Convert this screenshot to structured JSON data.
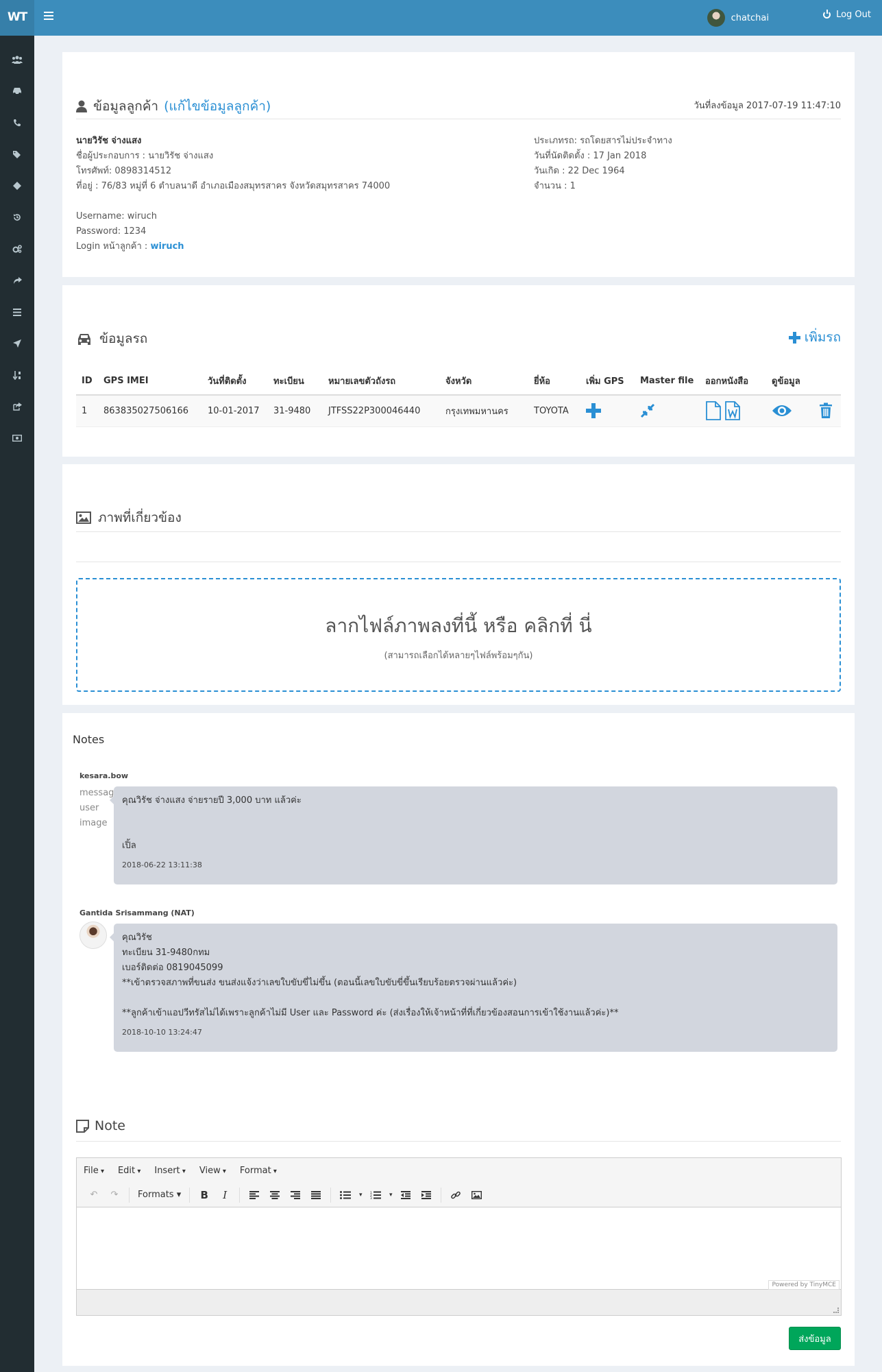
{
  "header": {
    "logo": "WT",
    "user_name": "chatchai",
    "logout_label": "Log Out"
  },
  "sidebar": {
    "icons": [
      "users-icon",
      "car-icon",
      "phone-icon",
      "tags-icon",
      "ticket-icon",
      "history-icon",
      "cogs-icon",
      "share-icon",
      "list-icon",
      "location-arrow-icon",
      "sort-icon",
      "share-square-icon",
      "money-icon"
    ]
  },
  "customer": {
    "title": "ข้อมูลลูกค้า",
    "edit_link": "(แก้ไขข้อมูลลูกค้า)",
    "record_date": "วันที่ลงข้อมูล 2017-07-19 11:47:10",
    "name": "นายวิรัช จ่างแสง",
    "operator": "ชื่อผู้ประกอบการ : นายวิรัช จ่างแสง",
    "phone": "โทรศัพท์: 0898314512",
    "address": "ที่อยู่ : 76/83 หมู่ที่ 6 ตำบลนาดี อำเภอเมืองสมุทรสาคร จังหวัดสมุทรสาคร 74000",
    "username": "Username: wiruch",
    "password": "Password: 1234",
    "login_label": "Login หน้าลูกค้า :",
    "login_link": "wiruch",
    "car_type": "ประเภทรถ: รถโดยสารไม่ประจำทาง",
    "install_date": "วันที่นัดติดตั้ง : 17 Jan 2018",
    "birth_date": "วันเกิด : 22 Dec 1964",
    "count": "จำนวน : 1"
  },
  "vehicles": {
    "title": "ข้อมูลรถ",
    "add_label": "เพิ่มรถ",
    "columns": [
      "ID",
      "GPS IMEI",
      "วันที่ติดตั้ง",
      "ทะเบียน",
      "หมายเลขตัวถังรถ",
      "จังหวัด",
      "ยี่ห้อ",
      "เพิ่ม GPS",
      "Master file",
      "ออกหนังสือ",
      "ดูข้อมูล"
    ],
    "rows": [
      {
        "id": "1",
        "imei": "863835027506166",
        "date": "10-01-2017",
        "plate": "31-9480",
        "chassis": "JTFSS22P300046440",
        "province": "กรุงเทพมหานคร",
        "brand": "TOYOTA"
      }
    ]
  },
  "images": {
    "title": "ภาพที่เกี่ยวข้อง",
    "dropzone_main": "ลากไฟล์ภาพลงที่นี้ หรือ คลิกที่ นี่",
    "dropzone_sub": "(สามารถเลือกได้หลายๆไฟล์พร้อมๆกัน)"
  },
  "notes": {
    "title": "Notes",
    "items": [
      {
        "author": "kesara.bow",
        "alt": "message user image",
        "lines": [
          "คุณวิรัช จ่างแสง จ่ายรายปี 3,000 บาท แล้วค่ะ",
          "",
          "",
          "เปิ้ล"
        ],
        "time": "2018-06-22 13:11:38"
      },
      {
        "author": "Gantida Srisammang (NAT)",
        "lines": [
          "คุณวิรัช",
          "ทะเบียน 31-9480กทม",
          "เบอร์ติดต่อ 0819045099",
          "**เข้าตรวจสภาพที่ขนส่ง ขนส่งแจ้งว่าเลขใบขับขี่ไม่ขึ้น (ตอนนี้เลขใบขับขี่ขึ้นเรียบร้อยตรวจผ่านแล้วค่ะ)",
          "",
          "**ลูกค้าเข้าแอปวีทรัสไม่ได้เพราะลูกค้าไม่มี User และ Password ค่ะ (ส่งเรื่องให้เจ้าหน้าที่ที่เกี่ยวข้องสอนการเข้าใช้งานแล้วค่ะ)**"
        ],
        "time": "2018-10-10 13:24:47"
      }
    ]
  },
  "note_editor": {
    "title": "Note",
    "menus": [
      "File",
      "Edit",
      "Insert",
      "View",
      "Format"
    ],
    "formats_label": "Formats",
    "powered": "Powered by TinyMCE",
    "submit": "ส่งข้อมูล"
  }
}
